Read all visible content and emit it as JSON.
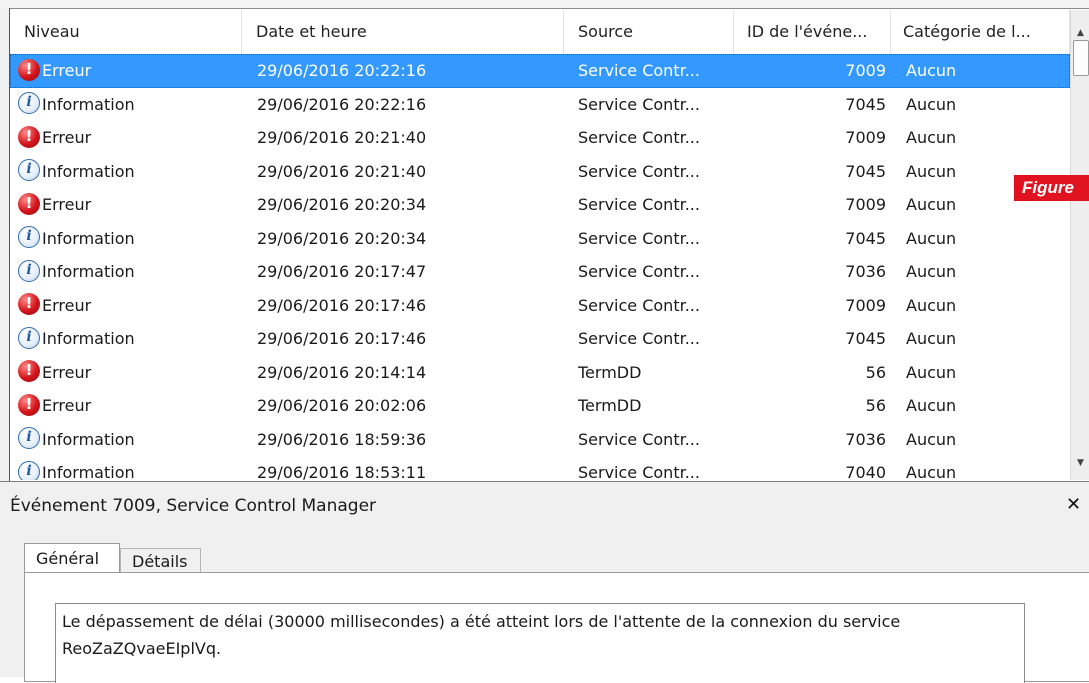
{
  "grid": {
    "columns": [
      "Niveau",
      "Date et heure",
      "Source",
      "ID de l'événe...",
      "Catégorie de l..."
    ],
    "rows": [
      {
        "level": "Erreur",
        "type": "error",
        "date": "29/06/2016 20:22:16",
        "source": "Service Contr...",
        "id": "7009",
        "category": "Aucun",
        "selected": true
      },
      {
        "level": "Information",
        "type": "info",
        "date": "29/06/2016 20:22:16",
        "source": "Service Contr...",
        "id": "7045",
        "category": "Aucun"
      },
      {
        "level": "Erreur",
        "type": "error",
        "date": "29/06/2016 20:21:40",
        "source": "Service Contr...",
        "id": "7009",
        "category": "Aucun"
      },
      {
        "level": "Information",
        "type": "info",
        "date": "29/06/2016 20:21:40",
        "source": "Service Contr...",
        "id": "7045",
        "category": "Aucun"
      },
      {
        "level": "Erreur",
        "type": "error",
        "date": "29/06/2016 20:20:34",
        "source": "Service Contr...",
        "id": "7009",
        "category": "Aucun"
      },
      {
        "level": "Information",
        "type": "info",
        "date": "29/06/2016 20:20:34",
        "source": "Service Contr...",
        "id": "7045",
        "category": "Aucun"
      },
      {
        "level": "Information",
        "type": "info",
        "date": "29/06/2016 20:17:47",
        "source": "Service Contr...",
        "id": "7036",
        "category": "Aucun"
      },
      {
        "level": "Erreur",
        "type": "error",
        "date": "29/06/2016 20:17:46",
        "source": "Service Contr...",
        "id": "7009",
        "category": "Aucun"
      },
      {
        "level": "Information",
        "type": "info",
        "date": "29/06/2016 20:17:46",
        "source": "Service Contr...",
        "id": "7045",
        "category": "Aucun"
      },
      {
        "level": "Erreur",
        "type": "error",
        "date": "29/06/2016 20:14:14",
        "source": "TermDD",
        "id": "56",
        "category": "Aucun"
      },
      {
        "level": "Erreur",
        "type": "error",
        "date": "29/06/2016 20:02:06",
        "source": "TermDD",
        "id": "56",
        "category": "Aucun"
      },
      {
        "level": "Information",
        "type": "info",
        "date": "29/06/2016 18:59:36",
        "source": "Service Contr...",
        "id": "7036",
        "category": "Aucun"
      },
      {
        "level": "Information",
        "type": "info",
        "date": "29/06/2016 18:53:11",
        "source": "Service Contr...",
        "id": "7040",
        "category": "Aucun"
      }
    ]
  },
  "icons": {
    "error": "error-icon",
    "info": "info-icon"
  },
  "colors": {
    "selection": "#3399ff",
    "error": "#d4141a",
    "info": "#2f6bb5",
    "figure_tag": "#e0121f"
  },
  "figure_tag": "Figure",
  "detail": {
    "title": "Événement 7009, Service Control Manager",
    "tabs": [
      "Général",
      "Détails"
    ],
    "message": "Le dépassement de délai (30000 millisecondes) a été atteint lors de l'attente de la connexion du service ReoZaZQvaeEIplVq."
  }
}
